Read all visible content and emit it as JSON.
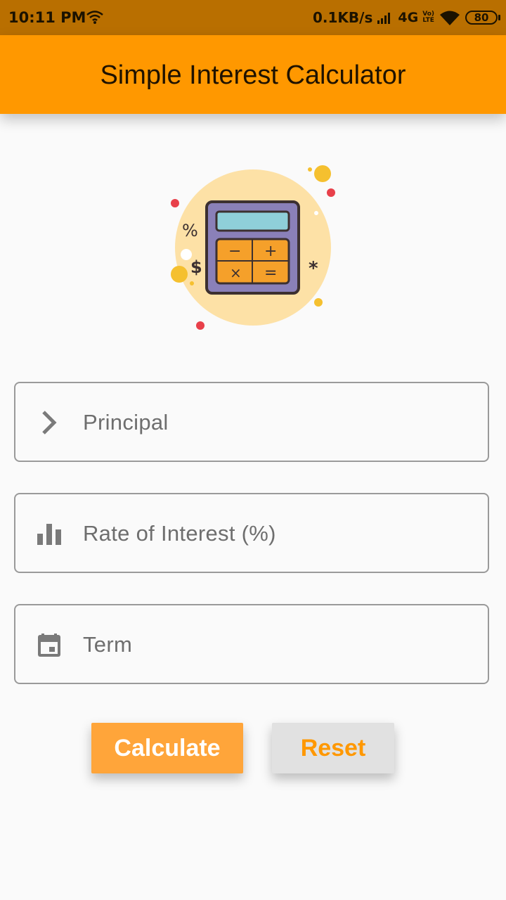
{
  "status_bar": {
    "time": "10:11 PM",
    "speed": "0.1KB/s",
    "network": "4G",
    "volte_top": "Vo)",
    "volte_bottom": "LTE",
    "battery": "80"
  },
  "app_bar": {
    "title": "Simple Interest Calculator"
  },
  "illustration": {
    "icon": "calculator-illustration",
    "symbols": [
      "%",
      "$",
      "*"
    ],
    "keys": [
      "−",
      "+",
      "×",
      "="
    ]
  },
  "form": {
    "principal": {
      "placeholder": "Principal",
      "icon": "chevron-right-icon"
    },
    "rate": {
      "placeholder": "Rate of Interest (%)",
      "icon": "bar-chart-icon"
    },
    "term": {
      "placeholder": "Term",
      "icon": "calendar-icon"
    }
  },
  "buttons": {
    "calculate": "Calculate",
    "reset": "Reset"
  },
  "colors": {
    "status_bar": "#b96f00",
    "app_bar": "#ff9800",
    "calculate_button": "#ffa53a",
    "reset_button": "#e1e1e1"
  }
}
